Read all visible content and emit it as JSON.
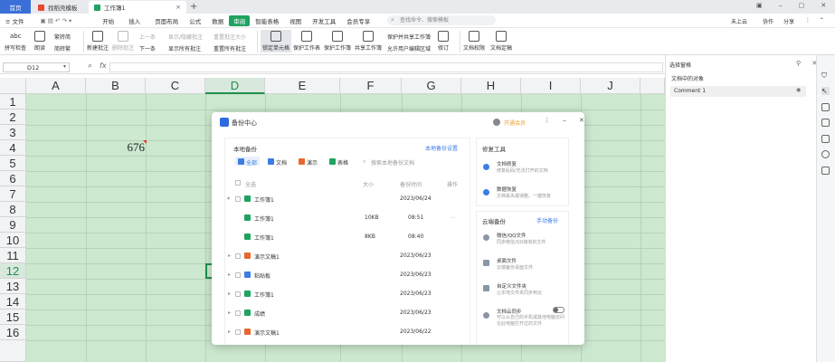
{
  "tabs": {
    "home": "首页",
    "template": "找稻壳模板",
    "workbook": "工作簿1",
    "add": "+"
  },
  "menu": {
    "file": "≡ 文件",
    "items": [
      "开始",
      "插入",
      "页面布局",
      "公式",
      "数据",
      "审阅",
      "智能表格",
      "视图",
      "开发工具",
      "会员专享"
    ],
    "search": "查找命令、搜索模板",
    "unsaved": "未上云",
    "cooperate": "协作",
    "share": "分享"
  },
  "ribbon": {
    "spellcheck": "拼写检查",
    "read": "朗读",
    "trad": "繁转简",
    "simp": "简转繁",
    "new_comment": "新建批注",
    "del_comment": "删除批注",
    "prev": "上一条",
    "next": "下一条",
    "show_hide": "显示/隐藏批注",
    "show_all": "显示所有批注",
    "reset_size": "重置批注大小",
    "reset_all": "重置所有批注",
    "lock_cell": "锁定单元格",
    "protect_sheet": "保护工作表",
    "protect_book": "保护工作簿",
    "share_book": "共享工作簿",
    "protect_share": "保护并共享工作簿",
    "allow_edit": "允许用户编辑区域",
    "revise": "修订",
    "doc_perm": "文档权限",
    "doc_finalize": "文档定稿"
  },
  "formula": {
    "cell": "D12",
    "fx": "fx"
  },
  "sheet": {
    "columns": [
      "A",
      "B",
      "C",
      "D",
      "E",
      "F",
      "G",
      "H",
      "I",
      "J"
    ],
    "rows": [
      "1",
      "2",
      "3",
      "4",
      "5",
      "6",
      "7",
      "8",
      "9",
      "10",
      "11",
      "12",
      "13",
      "14",
      "15",
      "16"
    ],
    "cell_b4": "676"
  },
  "taskpane": {
    "title": "选择窗格",
    "subtitle": "文档中的对象",
    "item": "Comment 1"
  },
  "dialog": {
    "title": "备份中心",
    "vip": "开通会员",
    "local_title": "本地备份",
    "local_settings": "本地备份设置",
    "filters": [
      "全部",
      "文档",
      "演示",
      "表格"
    ],
    "search": "搜索本地备份文档",
    "col_all": "全选",
    "col_size": "大小",
    "col_time": "备份时间",
    "col_action": "操作",
    "rows": [
      {
        "name": "工作簿1",
        "size": "",
        "time": "2023/06/24",
        "type": "sheet",
        "level": 0,
        "expanded": true
      },
      {
        "name": "工作簿1",
        "size": "10KB",
        "time": "08:51",
        "type": "sheet",
        "level": 1,
        "expanded": false
      },
      {
        "name": "工作簿1",
        "size": "8KB",
        "time": "08:40",
        "type": "sheet",
        "level": 1,
        "expanded": false
      },
      {
        "name": "演示文稿1",
        "size": "",
        "time": "2023/06/23",
        "type": "ppt",
        "level": 0,
        "expanded": false
      },
      {
        "name": "粘贴板",
        "size": "",
        "time": "2023/06/23",
        "type": "doc",
        "level": 0,
        "expanded": false
      },
      {
        "name": "工作簿1",
        "size": "",
        "time": "2023/06/23",
        "type": "sheet",
        "level": 0,
        "expanded": false
      },
      {
        "name": "成绩",
        "size": "",
        "time": "2023/06/23",
        "type": "sheet",
        "level": 0,
        "expanded": false
      },
      {
        "name": "演示文稿1",
        "size": "",
        "time": "2023/06/22",
        "type": "ppt",
        "level": 0,
        "expanded": false
      }
    ],
    "repair_title": "修复工具",
    "repair": [
      {
        "name": "文档修复",
        "desc": "修复乱码/无法打开的文档"
      },
      {
        "name": "数据恢复",
        "desc": "文档丢失或误删，一键恢复"
      }
    ],
    "cloud_title": "云端备份",
    "cloud_manual": "手动备份",
    "cloud": [
      {
        "name": "微信/QQ文件",
        "desc": "同步微信/QQ接收的文件"
      },
      {
        "name": "桌面文件",
        "desc": "云端备份桌面文件"
      },
      {
        "name": "自定义文件夹",
        "desc": "让本地文件夹同步到云"
      },
      {
        "name": "文档云同步",
        "desc": "可以从自己的手机或其他电脑访问在此电脑打开过的文件"
      }
    ]
  },
  "colors": {
    "accent": "#1ea361",
    "home_tab": "#3b6fd8",
    "grid_bg": "#cce8cf",
    "vip": "#f0a030"
  }
}
